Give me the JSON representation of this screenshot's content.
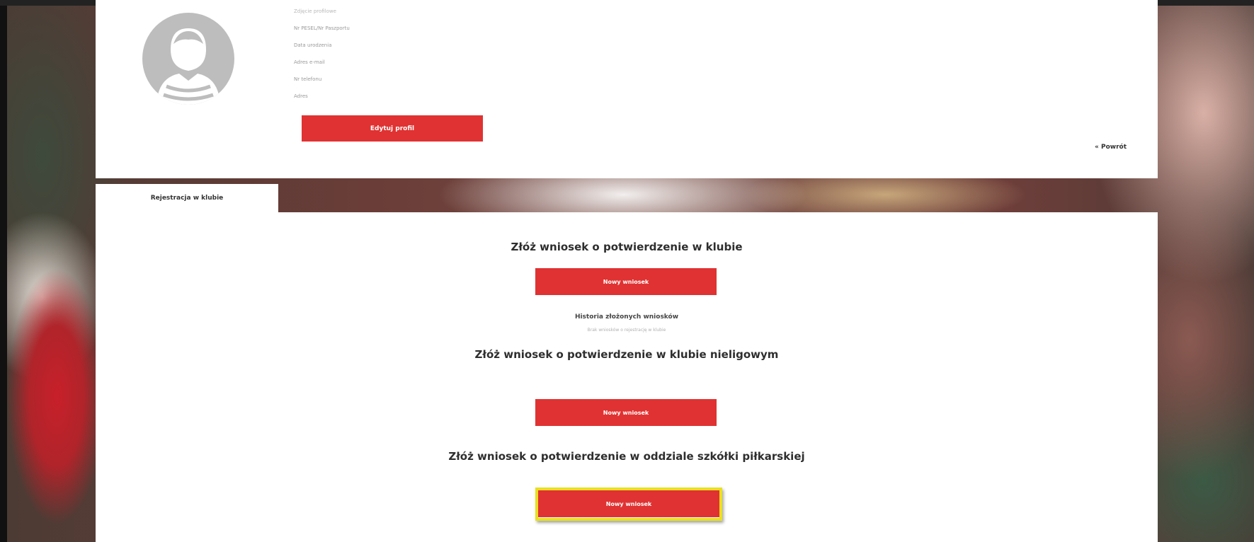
{
  "profile": {
    "fields": [
      "Zdjęcie profilowe",
      "Nr PESEL/Nr Paszportu",
      "Data urodzenia",
      "Adres e-mail",
      "Nr telefonu",
      "Adres"
    ],
    "edit_button": "Edytuj profil",
    "back_link": "« Powrót"
  },
  "tabs": {
    "active": "Rejestracja w klubie"
  },
  "sections": [
    {
      "heading": "Złóż wniosek o potwierdzenie w klubie",
      "button": "Nowy wniosek",
      "history_title": "Historia złożonych wniosków",
      "history_sub": "Brak wniosków o rejestrację w klubie"
    },
    {
      "heading": "Złóż wniosek o potwierdzenie w klubie nieligowym",
      "button": "Nowy wniosek"
    },
    {
      "heading": "Złóż wniosek o potwierdzenie w oddziale  szkółki piłkarskiej",
      "button": "Nowy wniosek"
    }
  ],
  "colors": {
    "accent": "#e03232",
    "highlight": "#e8e020"
  },
  "icons": {
    "avatar": "user-avatar-icon"
  }
}
